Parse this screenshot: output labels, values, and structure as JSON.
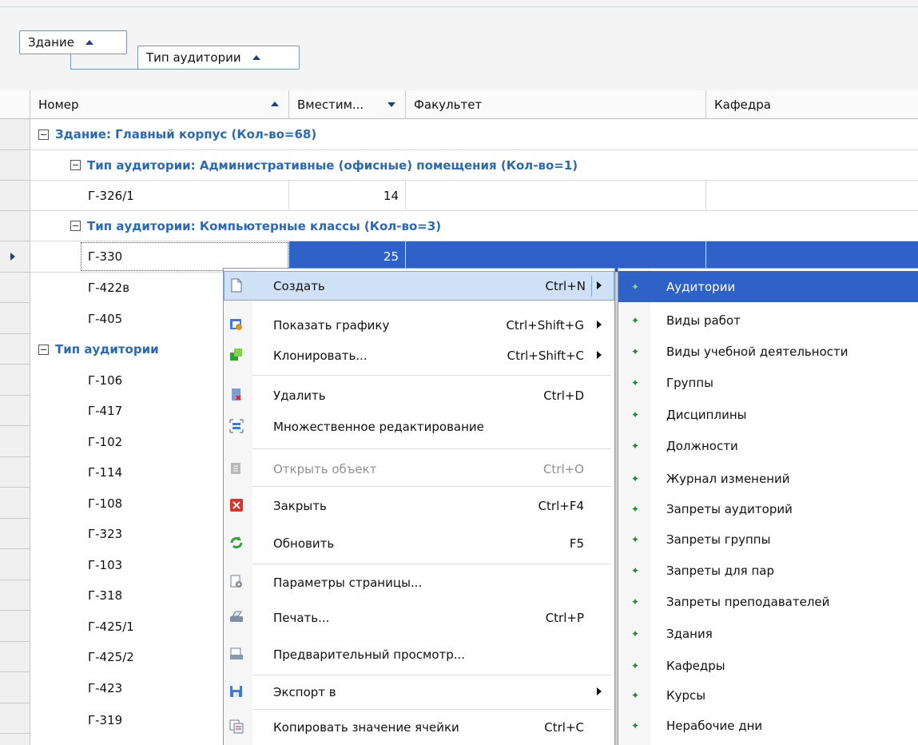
{
  "group_panel": {
    "chips": [
      {
        "label": "Здание"
      },
      {
        "label": "Тип аудитории"
      }
    ]
  },
  "columns": [
    {
      "label": "Номер"
    },
    {
      "label": "Вместим..."
    },
    {
      "label": "Факультет"
    },
    {
      "label": "Кафедра"
    }
  ],
  "groups": {
    "building": "Здание: Главный корпус (Кол-во=68)",
    "type_admin": "Тип аудитории: Административные (офисные) помещения (Кол-во=1)",
    "type_computer": "Тип аудитории: Компьютерные классы (Кол-во=3)",
    "type_third_partial": "Тип аудитории"
  },
  "rows": {
    "r326": {
      "number": "Г-326/1",
      "capacity": "14"
    },
    "r330": {
      "number": "Г-330",
      "capacity": "25"
    },
    "r422v": {
      "number": "Г-422в"
    },
    "r405": {
      "number": "Г-405"
    },
    "lecture": [
      "Г-106",
      "Г-417",
      "Г-102",
      "Г-114",
      "Г-108",
      "Г-323",
      "Г-103",
      "Г-318",
      "Г-425/1",
      "Г-425/2",
      "Г-423",
      "Г-319"
    ]
  },
  "context_menu": {
    "items": [
      {
        "label": "Создать",
        "shortcut": "Ctrl+N",
        "icon": "new-document-icon"
      },
      {
        "label": "Показать графику",
        "shortcut": "Ctrl+Shift+G",
        "icon": "graphics-icon"
      },
      {
        "label": "Клонировать...",
        "shortcut": "Ctrl+Shift+C",
        "icon": "clone-icon"
      },
      {
        "label": "Удалить",
        "shortcut": "Ctrl+D",
        "icon": "delete-icon"
      },
      {
        "label": "Множественное редактирование",
        "shortcut": "",
        "icon": "multi-edit-icon"
      },
      {
        "label": "Открыть объект",
        "shortcut": "Ctrl+O",
        "icon": "open-object-icon"
      },
      {
        "label": "Закрыть",
        "shortcut": "Ctrl+F4",
        "icon": "close-icon"
      },
      {
        "label": "Обновить",
        "shortcut": "F5",
        "icon": "refresh-icon"
      },
      {
        "label": "Параметры страницы...",
        "shortcut": "",
        "icon": "page-setup-icon"
      },
      {
        "label": "Печать...",
        "shortcut": "Ctrl+P",
        "icon": "print-icon"
      },
      {
        "label": "Предварительный просмотр...",
        "shortcut": "",
        "icon": "print-preview-icon"
      },
      {
        "label": "Экспорт в",
        "shortcut": "",
        "icon": "export-icon"
      },
      {
        "label": "Копировать значение ячейки",
        "shortcut": "Ctrl+C",
        "icon": "copy-cell-icon"
      }
    ]
  },
  "submenu": {
    "items": [
      "Аудитории",
      "Виды работ",
      "Виды учебной деятельности",
      "Группы",
      "Дисциплины",
      "Должности",
      "Журнал изменений",
      "Запреты аудиторий",
      "Запреты группы",
      "Запреты для пар",
      "Запреты преподавателей",
      "Здания",
      "Кафедры",
      "Курсы",
      "Нерабочие дни"
    ]
  },
  "colors": {
    "accent": "#2f62c7",
    "group_text": "#2a69b3",
    "highlight": "#cfe1f7"
  }
}
